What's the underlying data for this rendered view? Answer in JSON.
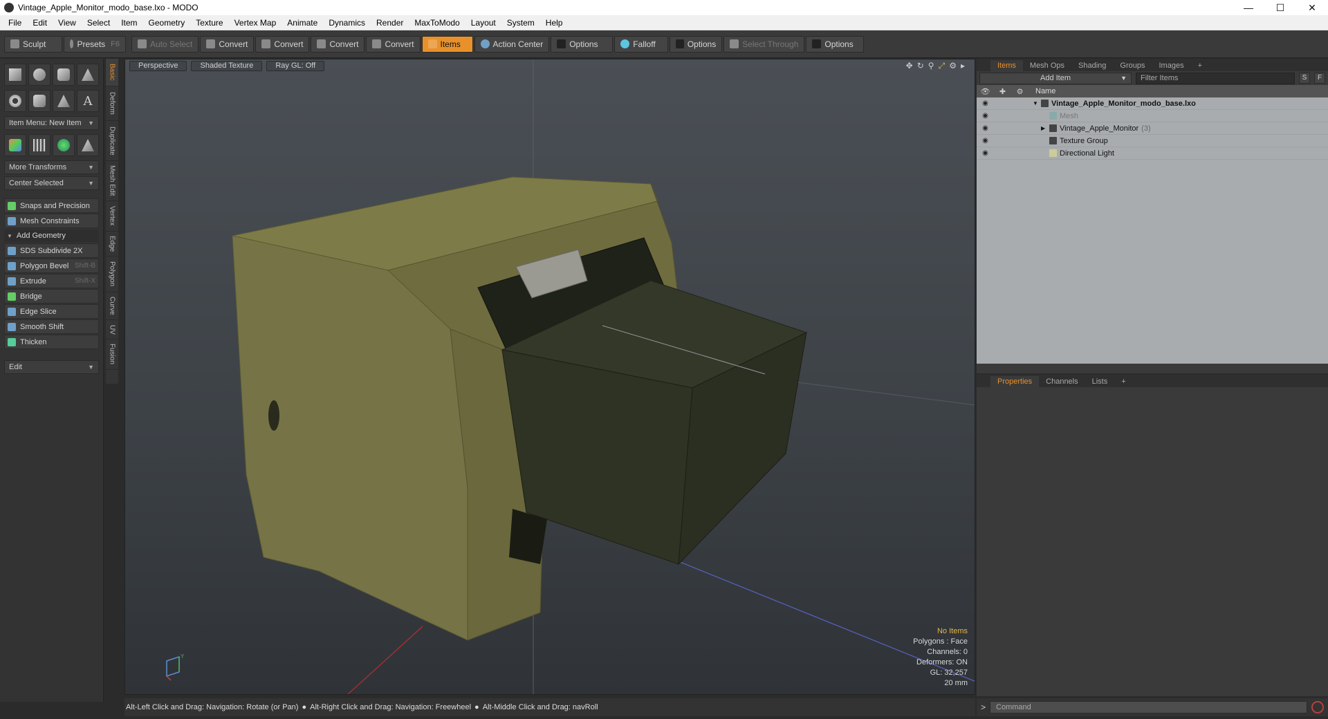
{
  "window": {
    "title": "Vintage_Apple_Monitor_modo_base.lxo - MODO"
  },
  "menu": [
    "File",
    "Edit",
    "View",
    "Select",
    "Item",
    "Geometry",
    "Texture",
    "Vertex Map",
    "Animate",
    "Dynamics",
    "Render",
    "MaxToModo",
    "Layout",
    "System",
    "Help"
  ],
  "toolbar": {
    "sculpt": "Sculpt",
    "presets": "Presets",
    "presets_shortcut": "F6",
    "auto_select": "Auto Select",
    "convert": "Convert",
    "items": "Items",
    "action_center": "Action Center",
    "options": "Options",
    "falloff": "Falloff",
    "select_through": "Select Through"
  },
  "left": {
    "item_menu": "Item Menu: New Item",
    "more_transforms": "More Transforms",
    "center_selected": "Center Selected",
    "snaps": "Snaps and Precision",
    "mesh_constraints": "Mesh Constraints",
    "add_geometry": "Add Geometry",
    "tools": [
      {
        "label": "SDS Subdivide 2X",
        "shortcut": ""
      },
      {
        "label": "Polygon Bevel",
        "shortcut": "Shift-B"
      },
      {
        "label": "Extrude",
        "shortcut": "Shift-X"
      },
      {
        "label": "Bridge",
        "shortcut": ""
      },
      {
        "label": "Edge Slice",
        "shortcut": ""
      },
      {
        "label": "Smooth Shift",
        "shortcut": ""
      },
      {
        "label": "Thicken",
        "shortcut": ""
      }
    ],
    "edit": "Edit"
  },
  "vtabs": [
    "Basic",
    "Deform",
    "Duplicate",
    "Mesh Edit",
    "Vertex",
    "Edge",
    "Polygon",
    "Curve",
    "UV",
    "Fusion"
  ],
  "viewport": {
    "view": "Perspective",
    "shading": "Shaded Texture",
    "raygl": "Ray GL: Off",
    "stats": {
      "no_items": "No Items",
      "polygons": "Polygons : Face",
      "channels": "Channels: 0",
      "deformers": "Deformers: ON",
      "gl": "GL: 32,257",
      "scale": "20 mm"
    }
  },
  "status": {
    "hint1": "Alt-Left Click and Drag: Navigation: Rotate (or Pan)",
    "hint2": "Alt-Right Click and Drag: Navigation: Freewheel",
    "hint3": "Alt-Middle Click and Drag: navRoll"
  },
  "items_panel": {
    "tabs": [
      "Items",
      "Mesh Ops",
      "Shading",
      "Groups",
      "Images"
    ],
    "add_item": "Add Item",
    "filter_placeholder": "Filter Items",
    "btn_s": "S",
    "btn_f": "F",
    "col_name": "Name",
    "rows": [
      {
        "name": "Vintage_Apple_Monitor_modo_base.lxo",
        "count": ""
      },
      {
        "name": "Mesh",
        "count": ""
      },
      {
        "name": "Vintage_Apple_Monitor",
        "count": "(3)"
      },
      {
        "name": "Texture Group",
        "count": ""
      },
      {
        "name": "Directional Light",
        "count": ""
      }
    ]
  },
  "props_panel": {
    "tabs": [
      "Properties",
      "Channels",
      "Lists"
    ]
  },
  "command": {
    "placeholder": "Command"
  },
  "colors": {
    "accent": "#e8912a",
    "monitor_body": "#6b6a3e",
    "screen": "#2a2d22"
  }
}
